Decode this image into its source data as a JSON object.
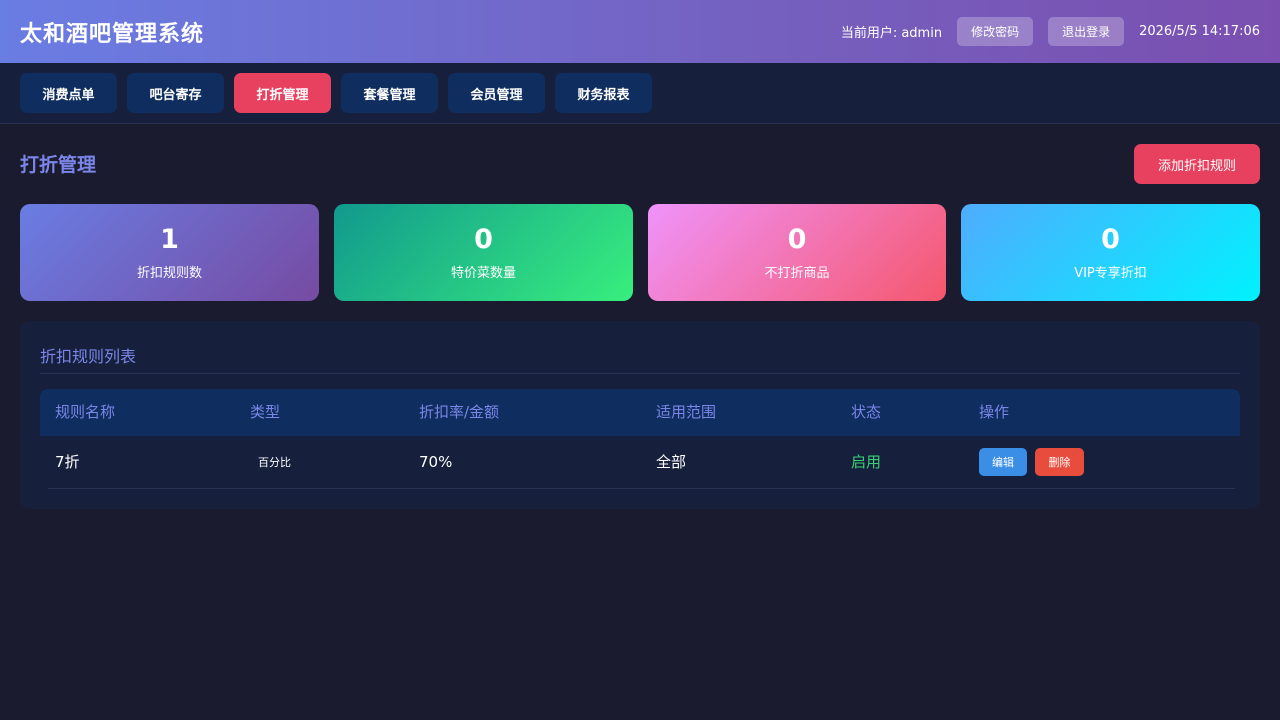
{
  "header": {
    "title": "太和酒吧管理系统",
    "current_user": "当前用户: admin",
    "change_password": "修改密码",
    "logout": "退出登录",
    "datetime": "2026/5/5 14:17:06"
  },
  "nav": {
    "tabs": [
      {
        "label": "消费点单",
        "active": false
      },
      {
        "label": "吧台寄存",
        "active": false
      },
      {
        "label": "打折管理",
        "active": true
      },
      {
        "label": "套餐管理",
        "active": false
      },
      {
        "label": "会员管理",
        "active": false
      },
      {
        "label": "财务报表",
        "active": false
      }
    ]
  },
  "page": {
    "title": "打折管理",
    "add_button": "添加折扣规则"
  },
  "stats": [
    {
      "value": "1",
      "label": "折扣规则数"
    },
    {
      "value": "0",
      "label": "特价菜数量"
    },
    {
      "value": "0",
      "label": "不打折商品"
    },
    {
      "value": "0",
      "label": "VIP专享折扣"
    }
  ],
  "rules_list": {
    "title": "折扣规则列表",
    "columns": [
      "规则名称",
      "类型",
      "折扣率/金额",
      "适用范围",
      "状态",
      "操作"
    ],
    "rows": [
      {
        "name": "7折",
        "type": "百分比",
        "rate": "70%",
        "scope": "全部",
        "status": "启用",
        "edit": "编辑",
        "delete": "删除"
      }
    ]
  },
  "colors": {
    "accent": "#e8405f",
    "heading": "#7b86e8",
    "enabled": "#3ccf72"
  }
}
